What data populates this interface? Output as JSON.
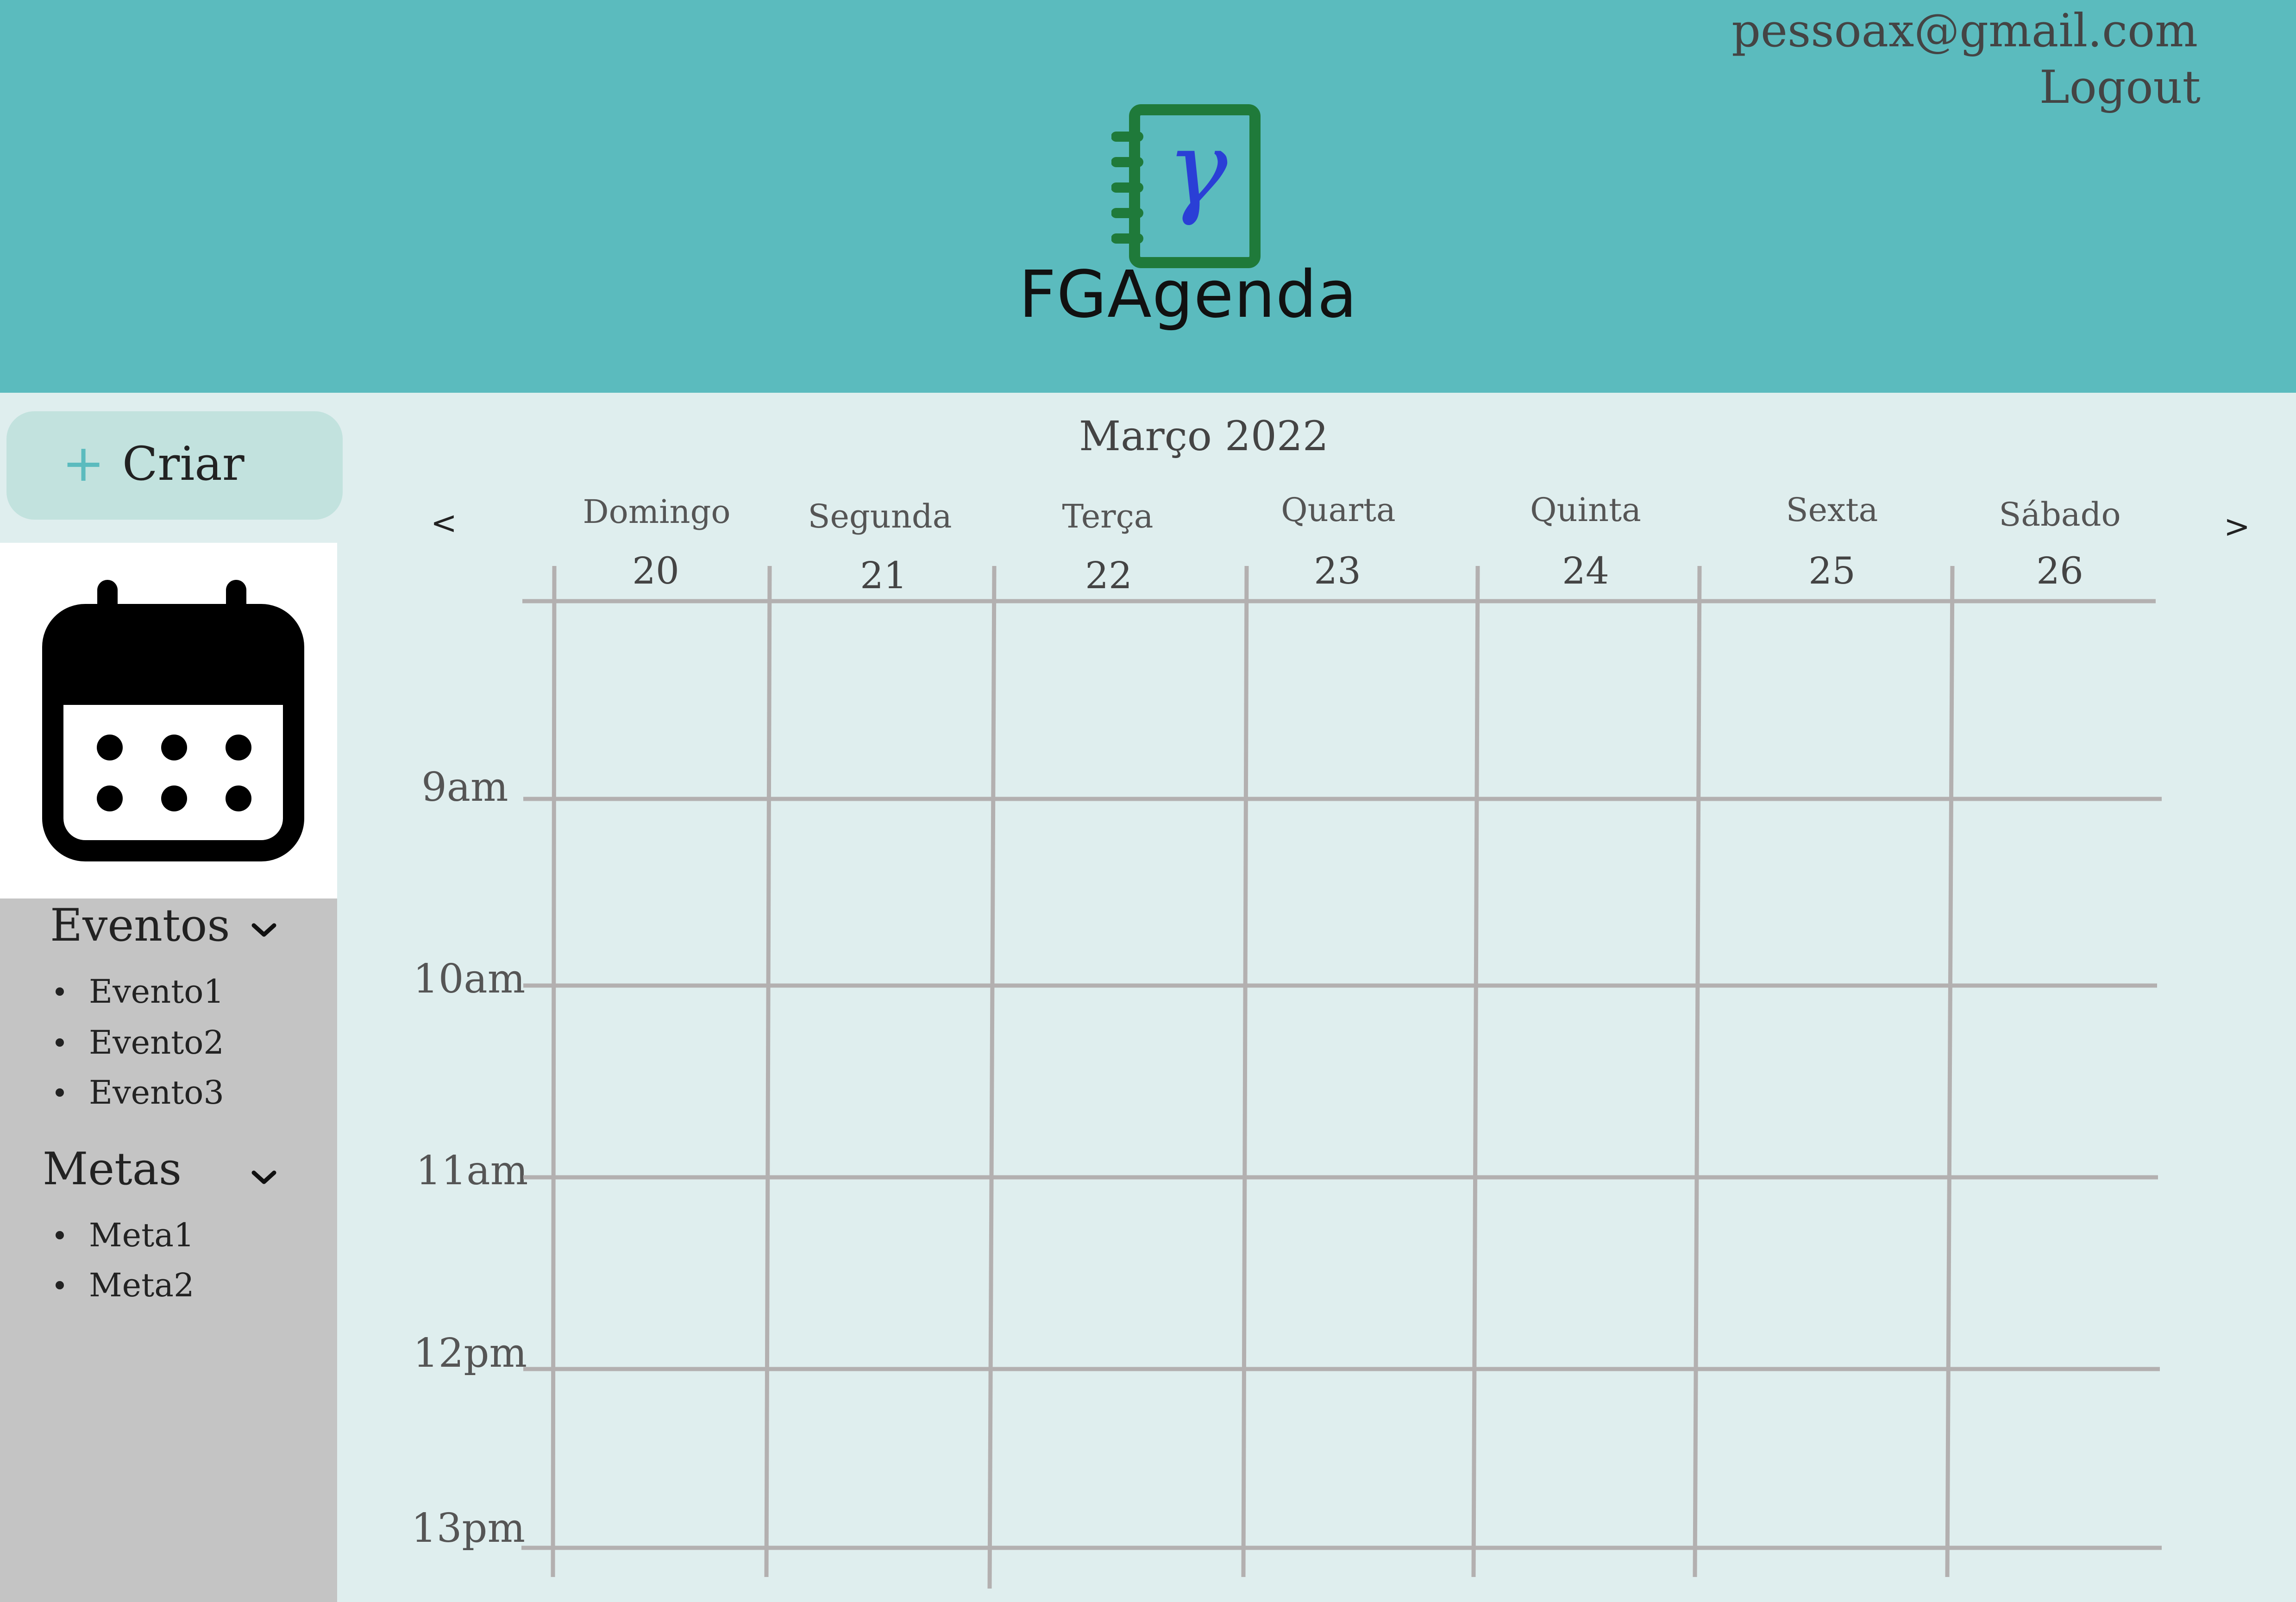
{
  "header": {
    "user_email": "pessoax@gmail.com",
    "logout_label": "Logout",
    "logo_text": "FGAgenda",
    "logo_symbol": "γ"
  },
  "sidebar": {
    "create_label": "Criar",
    "create_icon": "+",
    "calendar_icon": "calendar-icon",
    "sections": [
      {
        "title": "Eventos",
        "items": [
          "Evento1",
          "Evento2",
          "Evento3"
        ]
      },
      {
        "title": "Metas",
        "items": [
          "Meta1",
          "Meta2"
        ]
      }
    ]
  },
  "calendar": {
    "month_label": "Março 2022",
    "prev_label": "<",
    "next_label": ">",
    "days": [
      {
        "name": "Domingo",
        "number": "20"
      },
      {
        "name": "Segunda",
        "number": "21"
      },
      {
        "name": "Terça",
        "number": "22"
      },
      {
        "name": "Quarta",
        "number": "23"
      },
      {
        "name": "Quinta",
        "number": "24"
      },
      {
        "name": "Sexta",
        "number": "25"
      },
      {
        "name": "Sábado",
        "number": "26"
      }
    ],
    "hours": [
      "9am",
      "10am",
      "11am",
      "12pm",
      "13pm"
    ]
  },
  "colors": {
    "header_bg": "#5bbbbe",
    "page_bg": "#dfeeee",
    "sidebar_gray": "#c4c4c4",
    "create_button_bg": "#c2e2de",
    "grid_line": "#b3b0b0",
    "logo_green": "#1f7a3a",
    "logo_blue": "#2a3fd6"
  }
}
